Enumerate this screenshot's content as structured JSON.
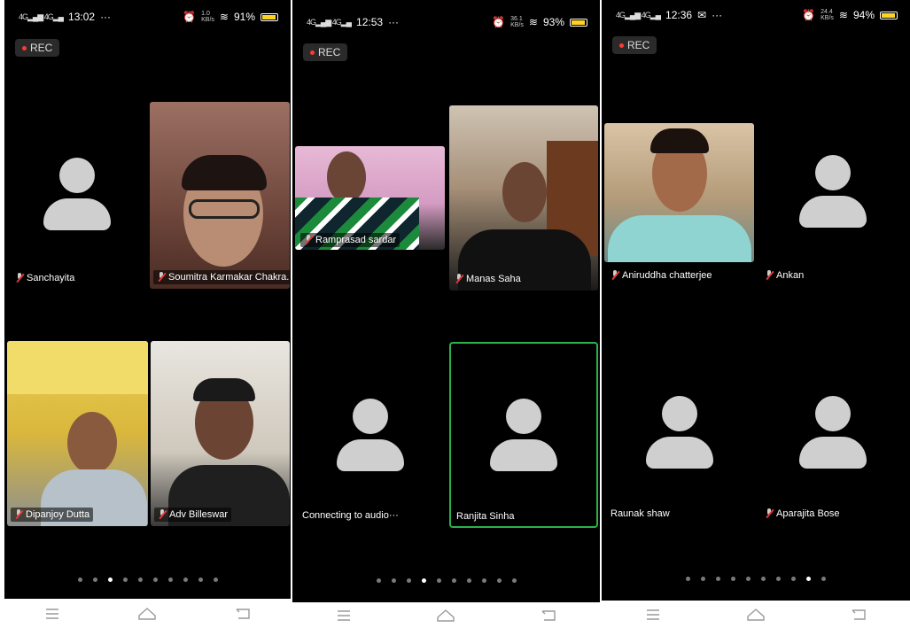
{
  "phones": [
    {
      "status": {
        "time": "13:02",
        "extra": "···",
        "battery": "91%"
      },
      "rec_label": "REC",
      "participants": [
        {
          "name": "Sanchayita",
          "muted": true,
          "video": false
        },
        {
          "name": "Soumitra Karmakar Chakra...",
          "muted": true,
          "video": true
        },
        {
          "name": "Dipanjoy Dutta",
          "muted": true,
          "video": true
        },
        {
          "name": "Adv Billeswar",
          "muted": true,
          "video": true
        }
      ],
      "page_dots": {
        "count": 10,
        "active_index": 2
      }
    },
    {
      "status": {
        "time": "12:53",
        "extra": "···",
        "battery": "93%"
      },
      "rec_label": "REC",
      "participants": [
        {
          "name": "Ramprasad  sardar",
          "muted": true,
          "video": true
        },
        {
          "name": "Manas Saha",
          "muted": true,
          "video": true
        },
        {
          "name": "Connecting to audio···",
          "muted": false,
          "video": false
        },
        {
          "name": "Ranjita Sinha",
          "muted": false,
          "video": false,
          "active_speaker": true
        }
      ],
      "page_dots": {
        "count": 10,
        "active_index": 3
      }
    },
    {
      "status": {
        "time": "12:36",
        "extra": "···",
        "battery": "94%"
      },
      "rec_label": "REC",
      "participants": [
        {
          "name": "Aniruddha chatterjee",
          "muted": true,
          "video": true
        },
        {
          "name": "Ankan",
          "muted": true,
          "video": false
        },
        {
          "name": "Raunak shaw",
          "muted": false,
          "video": false
        },
        {
          "name": "Aparajita Bose",
          "muted": true,
          "video": false
        }
      ],
      "page_dots": {
        "count": 10,
        "active_index": 8
      }
    }
  ],
  "navbar": {
    "icons": [
      "menu-icon",
      "home-icon",
      "back-icon"
    ]
  },
  "colors": {
    "background": "#000000",
    "active_border": "#2bb24c",
    "avatar": "#cfcfcf",
    "battery": "#ffd21f",
    "rec_dot": "#ff3b30"
  }
}
